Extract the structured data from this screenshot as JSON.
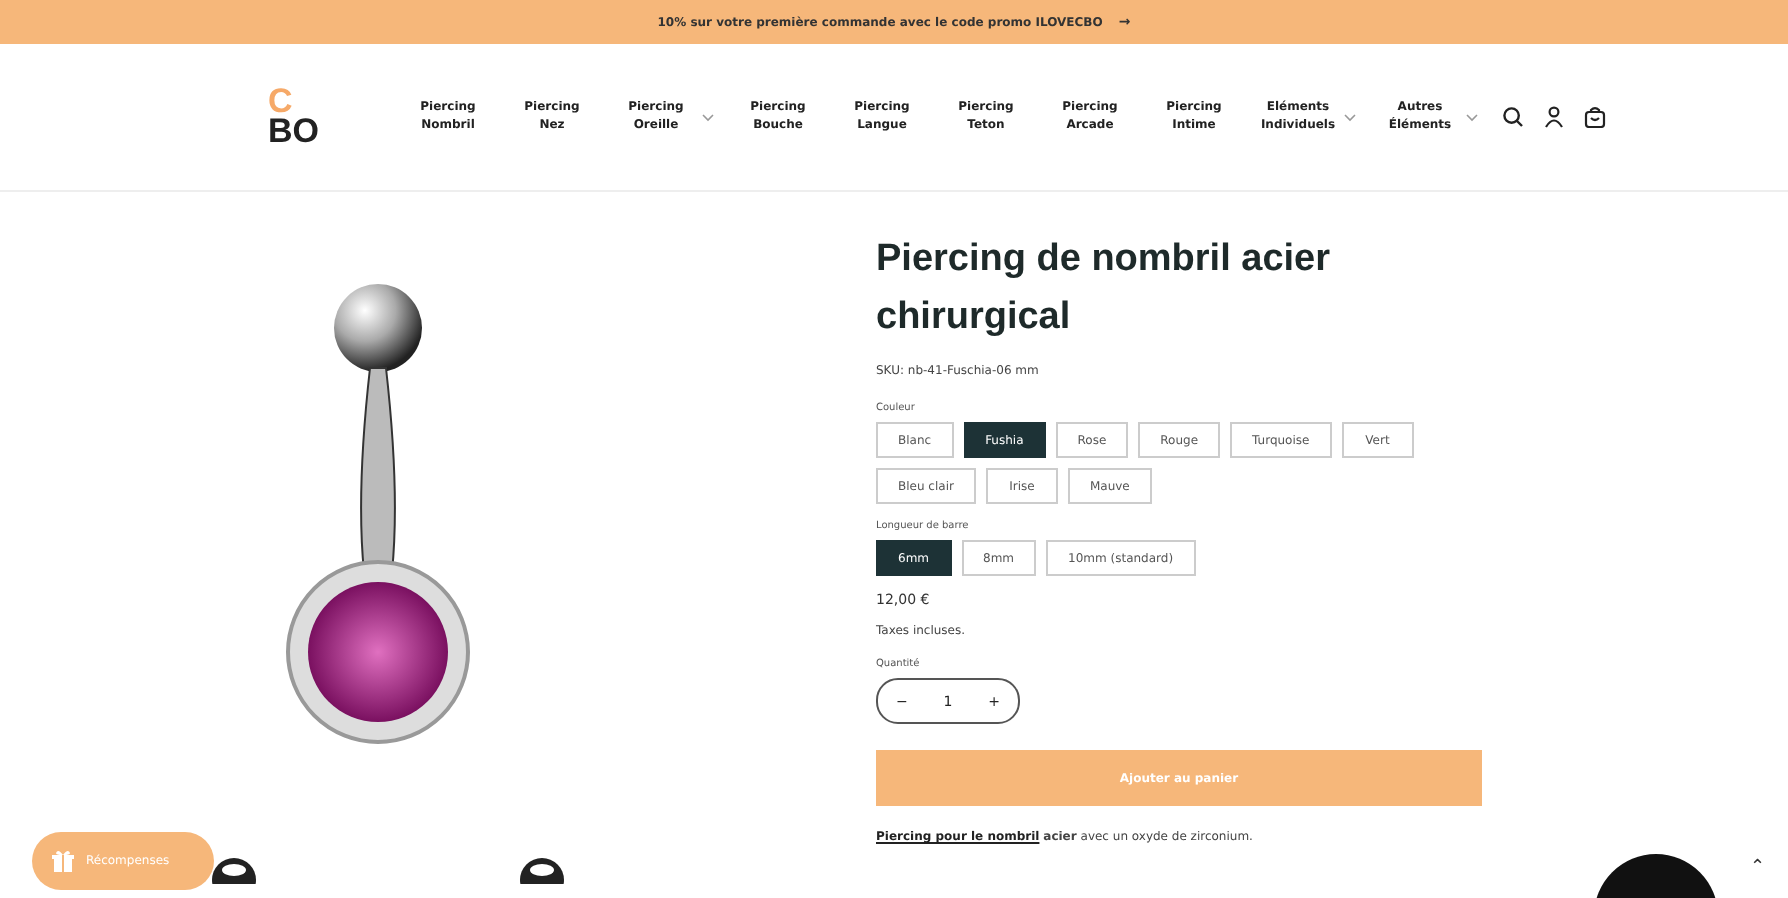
{
  "announcement": {
    "text": "10% sur votre première commande avec le code promo ILOVECBO",
    "arrow": "→"
  },
  "logo": {
    "line1": "C",
    "line2": "BO"
  },
  "nav": [
    {
      "label": "Piercing Nombril",
      "dropdown": false
    },
    {
      "label": "Piercing Nez",
      "dropdown": false
    },
    {
      "label": "Piercing Oreille",
      "dropdown": true
    },
    {
      "label": "Piercing Bouche",
      "dropdown": false
    },
    {
      "label": "Piercing Langue",
      "dropdown": false
    },
    {
      "label": "Piercing Teton",
      "dropdown": false
    },
    {
      "label": "Piercing Arcade",
      "dropdown": false
    },
    {
      "label": "Piercing Intime",
      "dropdown": false
    },
    {
      "label": "Eléments Individuels",
      "dropdown": true
    },
    {
      "label": "Autres Éléments",
      "dropdown": true
    }
  ],
  "product": {
    "title": "Piercing de nombril acier chirurgical",
    "sku": "SKU: nb-41-Fuschia-06 mm",
    "color_label": "Couleur",
    "colors": [
      {
        "label": "Blanc",
        "selected": false
      },
      {
        "label": "Fushia",
        "selected": true
      },
      {
        "label": "Rose",
        "selected": false
      },
      {
        "label": "Rouge",
        "selected": false
      },
      {
        "label": "Turquoise",
        "selected": false
      },
      {
        "label": "Vert",
        "selected": false
      },
      {
        "label": "Bleu clair",
        "selected": false
      },
      {
        "label": "Irise",
        "selected": false
      },
      {
        "label": "Mauve",
        "selected": false
      }
    ],
    "length_label": "Longueur de barre",
    "lengths": [
      {
        "label": "6mm",
        "selected": true
      },
      {
        "label": "8mm",
        "selected": false
      },
      {
        "label": "10mm (standard)",
        "selected": false
      }
    ],
    "price": "12,00 €",
    "tax": "Taxes incluses.",
    "quantity_label": "Quantité",
    "quantity": "1",
    "minus": "−",
    "plus": "+",
    "add_button": "Ajouter au panier",
    "description": {
      "link": "Piercing pour le nombril",
      "bold": "acier",
      "rest": "avec un oxyde de zirconium."
    }
  },
  "rewards_button": "Récompenses",
  "scroll_top": "⌃"
}
